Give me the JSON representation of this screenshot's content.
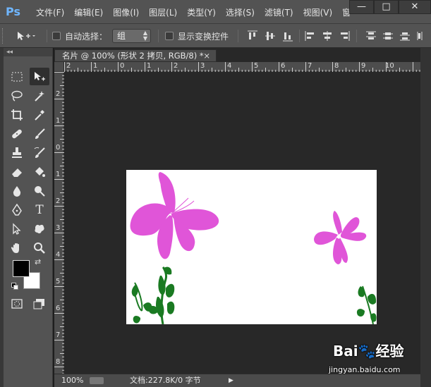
{
  "app": {
    "logo": "Ps"
  },
  "menu": [
    "文件(F)",
    "编辑(E)",
    "图像(I)",
    "图层(L)",
    "类型(Y)",
    "选择(S)",
    "滤镜(T)",
    "视图(V)",
    "窗"
  ],
  "window_controls": {
    "minimize": "—",
    "maximize": "□",
    "close": "✕"
  },
  "options": {
    "auto_select_label": "自动选择：",
    "auto_select_checked": false,
    "auto_select_value": "组",
    "show_transform_label": "显示变换控件",
    "show_transform_checked": false
  },
  "toolbox": {
    "collapse": "◂◂",
    "tools": [
      "marquee-tool",
      "move-tool",
      "lasso-tool",
      "magic-wand-tool",
      "crop-tool",
      "eyedropper-tool",
      "healing-brush-tool",
      "brush-tool",
      "clone-stamp-tool",
      "history-brush-tool",
      "eraser-tool",
      "paint-bucket-tool",
      "blur-tool",
      "dodge-tool",
      "pen-tool",
      "type-tool",
      "path-selection-tool",
      "custom-shape-tool",
      "hand-tool",
      "zoom-tool",
      "quick-mask-tool",
      "screen-mode-tool"
    ],
    "active_tool": "move-tool",
    "type_glyph": "T",
    "foreground_color": "#000000",
    "background_color": "#ffffff"
  },
  "document": {
    "tab_title": "名片 @ 100% (形状 2 拷贝, RGB/8) *",
    "tab_close": "×",
    "ruler_top": [
      "2",
      "1",
      "0",
      "1",
      "2",
      "3",
      "4",
      "5",
      "6",
      "7",
      "8",
      "9",
      "10"
    ],
    "ruler_left": [
      "2",
      "1",
      "0",
      "1",
      "2",
      "3",
      "4",
      "5",
      "6",
      "7",
      "8"
    ],
    "canvas_color": "#ffffff",
    "butterfly_color": "#e055d8",
    "plant_color": "#1a7a22"
  },
  "status": {
    "zoom": "100%",
    "doc_info": "文档:227.8K/0 字节",
    "arrow": "▶"
  },
  "watermark": {
    "brand": "Bai",
    "brand_end": "经验",
    "url": "jingyan.baidu.com"
  }
}
